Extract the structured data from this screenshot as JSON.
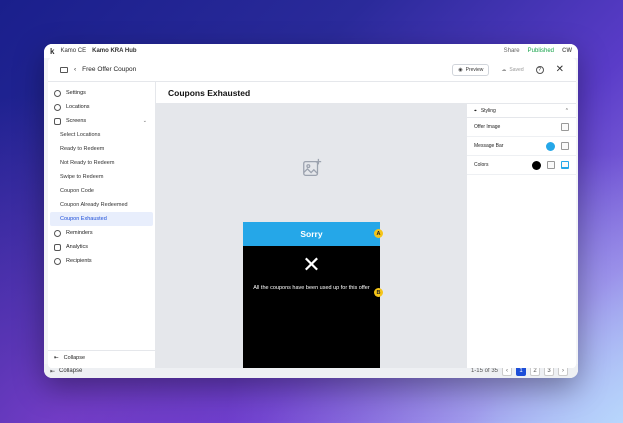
{
  "background_app": {
    "title_left": "Kamo CE",
    "title_right": "Kamo KRA Hub",
    "right_items": [
      "Share",
      "Published",
      "CW"
    ],
    "collapse_label": "Collapse",
    "pager": {
      "range_text": "1-15 of 35",
      "prev": "‹",
      "pages": [
        "1",
        "2",
        "3"
      ],
      "active_page": "1",
      "next": "›"
    }
  },
  "header": {
    "back_arrow": "‹",
    "title": "Free Offer Coupon",
    "preview_label": "Preview",
    "saved_label": "Saved",
    "help": "?",
    "close": "✕"
  },
  "sidebar": {
    "items": [
      {
        "label": "Settings",
        "icon": "gear-icon"
      },
      {
        "label": "Locations",
        "icon": "location-icon"
      },
      {
        "label": "Screens",
        "icon": "phone-icon",
        "chevron": "⌄"
      }
    ],
    "screens": [
      {
        "label": "Select Locations"
      },
      {
        "label": "Ready to Redeem"
      },
      {
        "label": "Not Ready to Redeem"
      },
      {
        "label": "Swipe to Redeem"
      },
      {
        "label": "Coupon Code"
      },
      {
        "label": "Coupon Already Redeemed"
      },
      {
        "label": "Coupon Exhausted",
        "active": true
      }
    ],
    "bottom_items": [
      {
        "label": "Reminders",
        "icon": "clock-icon"
      },
      {
        "label": "Analytics",
        "icon": "chart-icon"
      },
      {
        "label": "Recipients",
        "icon": "users-icon"
      }
    ],
    "collapse_label": "Collapse"
  },
  "main": {
    "title": "Coupons Exhausted",
    "preview": {
      "message_bar_text": "Sorry",
      "close_glyph": "✕",
      "body_text": "All the coupons have been used up for this offer",
      "marker_a": "A",
      "marker_b": "B",
      "message_bar_color": "#25a7e8"
    }
  },
  "panel": {
    "title": "Styling",
    "rows": [
      {
        "label": "Offer Image"
      },
      {
        "label": "Message Bar",
        "swatch_color": "#25a7e8"
      },
      {
        "label": "Colors",
        "swatch_color": "#000000"
      }
    ]
  }
}
